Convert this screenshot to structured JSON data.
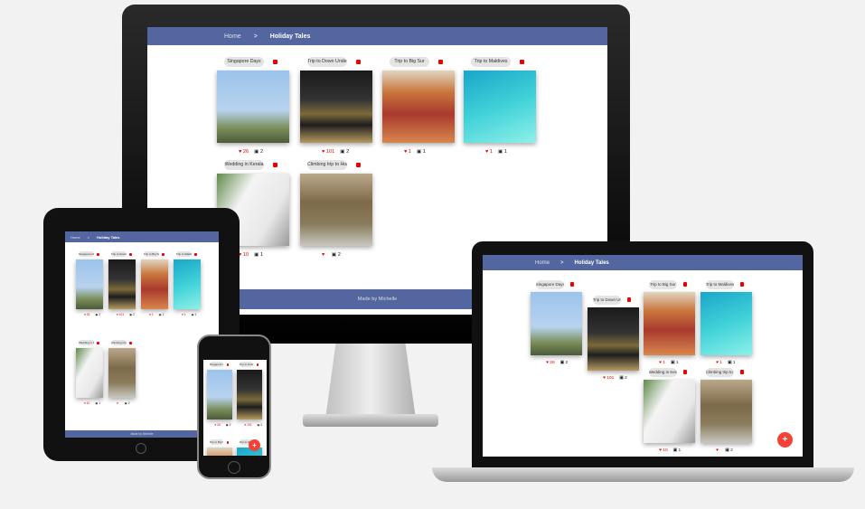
{
  "header": {
    "home": "Home",
    "separator": ">",
    "current": "Holiday Tales"
  },
  "footer": {
    "text": "Made by Michelle"
  },
  "fab": {
    "label": "+"
  },
  "albums": [
    {
      "title": "Singapore Days",
      "likes": "26",
      "photos": "2"
    },
    {
      "title": "Trip to Down Under",
      "likes": "101",
      "photos": "2"
    },
    {
      "title": "Trip to Big Sur",
      "likes": "1",
      "photos": "1"
    },
    {
      "title": "Trip to Maldives",
      "likes": "1",
      "photos": "1"
    },
    {
      "title": "Wedding in Kerala",
      "likes": "10",
      "photos": "1"
    },
    {
      "title": "Climbing trip to Holland",
      "likes": "",
      "photos": "2"
    }
  ],
  "colors": {
    "header": "#5366a0",
    "delete": "#e00000",
    "fab": "#f44336"
  }
}
